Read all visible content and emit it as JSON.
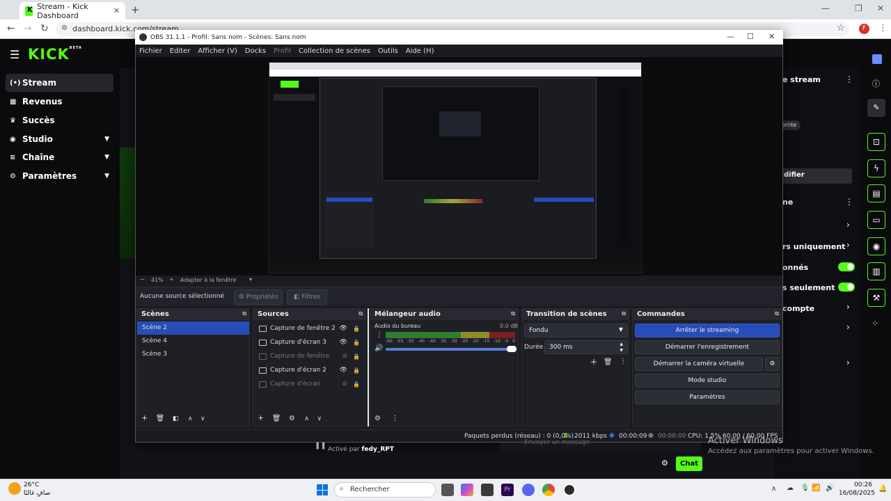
{
  "browser": {
    "tab_title": "Stream - Kick Dashboard",
    "tab_close": "✕",
    "new_tab": "+",
    "url": "dashboard.kick.com/stream",
    "profile_initial": "F",
    "window_min": "—",
    "window_max": "❐",
    "window_close": "✕"
  },
  "kick": {
    "logo": "KICK",
    "logo_badge": "BETA",
    "sidebar": [
      {
        "label": "Stream",
        "icon": "(•)"
      },
      {
        "label": "Revenus",
        "icon": "▦"
      },
      {
        "label": "Succès",
        "icon": "♛"
      },
      {
        "label": "Studio",
        "icon": "◉"
      },
      {
        "label": "Chaîne",
        "icon": "≡"
      },
      {
        "label": "Paramètres",
        "icon": "⚙"
      }
    ],
    "right_panel": {
      "stream_header": "e stream",
      "badge": "ornte",
      "modify": "difier",
      "section_header": "ne",
      "row_subscribers": "rs uniquement",
      "row_followers": "onnés",
      "row_only": "s seulement",
      "row_account": "compte"
    },
    "activated_by_prefix": "Activé par",
    "activated_by_user": "fedy_RPT",
    "chat_button": "Chat",
    "chat_placeholder": "Envoyer un message"
  },
  "obs": {
    "title": "OBS 31.1.1 - Profil: Sans nom - Scènes: Sans nom",
    "menu": [
      "Fichier",
      "Editer",
      "Afficher (V)",
      "Docks",
      "Profil",
      "Collection de scènes",
      "Outils",
      "Aide (H)"
    ],
    "zoom": "41%",
    "zoom_fit": "Adapter à la fenêtre",
    "no_source": "Aucune source sélectionné",
    "properties_btn": "Propriétés",
    "filters_btn": "Filtres",
    "scenes_title": "Scènes",
    "scenes": [
      "Scène 2",
      "Scène 4",
      "Scène 3"
    ],
    "sources_title": "Sources",
    "sources": [
      {
        "name": "Capture de fenêtre 2",
        "disabled": false
      },
      {
        "name": "Capture d'écran 3",
        "disabled": false
      },
      {
        "name": "Capture de fenêtre",
        "disabled": true
      },
      {
        "name": "Capture d'écran 2",
        "disabled": false
      },
      {
        "name": "Capture d'écran",
        "disabled": true
      }
    ],
    "mixer_title": "Mélangeur audio",
    "mixer_channel": "Audio du bureau",
    "mixer_db": "0.0 dB",
    "mixer_scale": [
      "-60",
      "-55",
      "-50",
      "-45",
      "-40",
      "-35",
      "-30",
      "-25",
      "-20",
      "-15",
      "-10",
      "-5",
      "0"
    ],
    "transition_title": "Transition de scènes",
    "transition_value": "Fondu",
    "duration_label": "Durée",
    "duration_value": "300 ms",
    "commands_title": "Commandes",
    "commands": [
      "Arrêter le streaming",
      "Démarrer l'enregistrement",
      "Démarrer la caméra virtuelle",
      "Mode studio",
      "Paramètres"
    ],
    "status": {
      "dropped": "Paquets perdus (réseau) : 0 (0,0%)",
      "bitrate": "2011 kbps",
      "stream_time": "00:00:09",
      "rec_time": "00:00:00",
      "cpu": "CPU: 1.5%",
      "fps": "60.00 / 60.00 FPS"
    }
  },
  "windows": {
    "activate_title": "Activer Windows",
    "activate_sub": "Accédez aux paramètres pour activer Windows.",
    "search": "Rechercher",
    "weather_temp": "26°C",
    "weather_desc": "صافٍ غالبًا",
    "time": "00:26",
    "date": "16/08/2025"
  },
  "colors": {
    "kick_green": "#53fc18",
    "obs_accent": "#284cb8",
    "obs_bg": "#1b1c22"
  }
}
